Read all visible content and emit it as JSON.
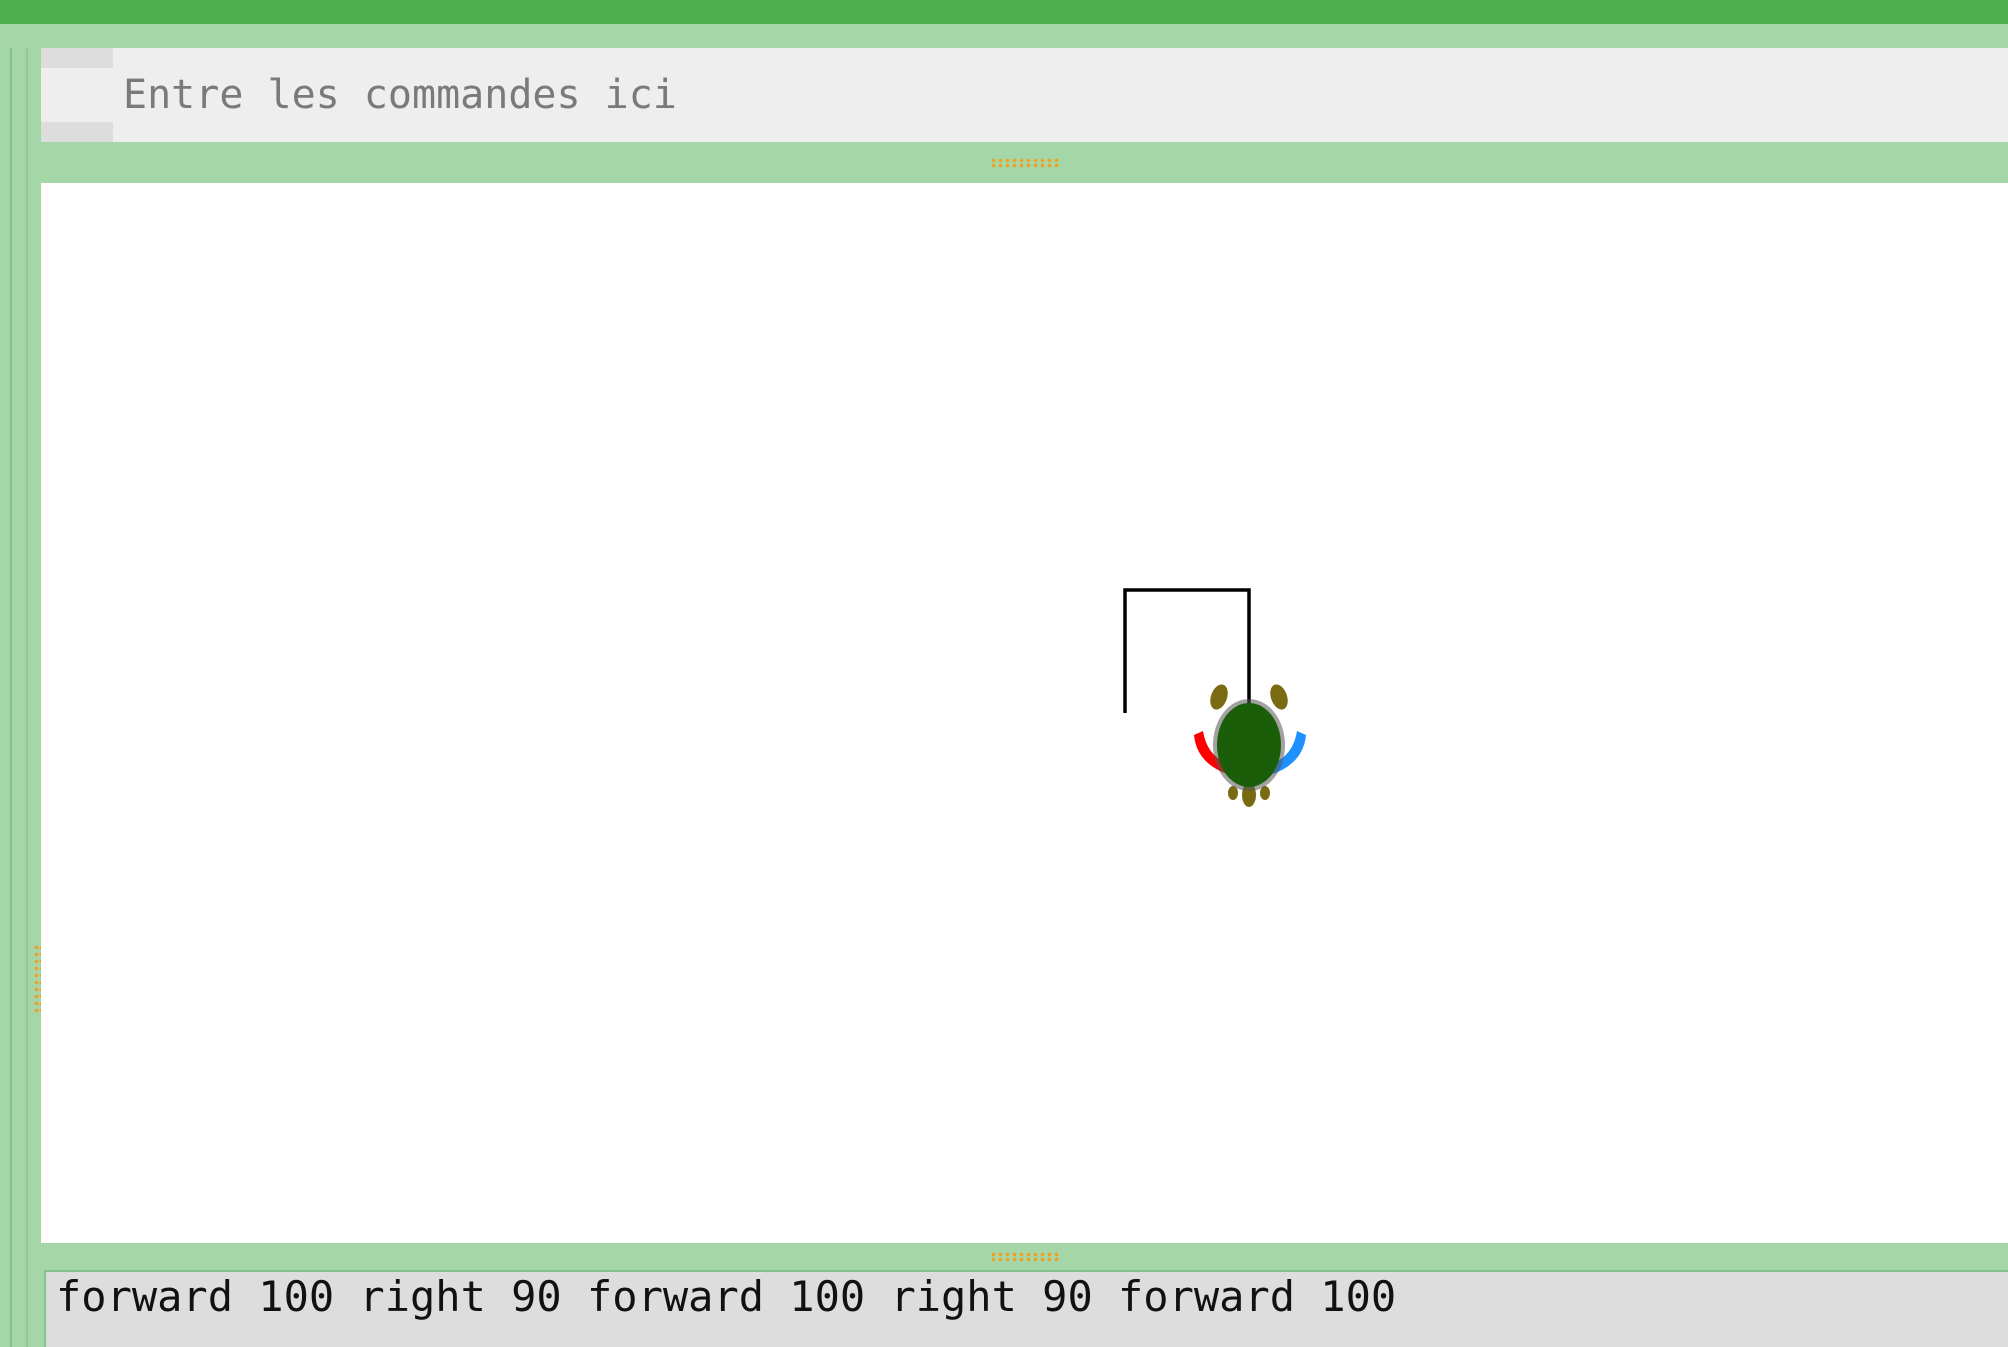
{
  "command_panel": {
    "placeholder": "Entre les commandes ici",
    "value": ""
  },
  "canvas": {
    "turtle": {
      "icon": "turtle-icon",
      "heading": "down",
      "shell_color": "#1b5e0a",
      "limb_color": "#7a6a12",
      "left_fin_color": "#ff0000",
      "right_fin_color": "#1e90ff"
    },
    "trail": {
      "color": "#000000",
      "commands_drawn": [
        "forward 100",
        "right 90",
        "forward 100",
        "right 90",
        "forward 100"
      ]
    }
  },
  "history": {
    "text": "forward 100 right 90 forward 100 right 90 forward 100"
  },
  "colors": {
    "top_bar": "#4caf50",
    "frame": "#a5d6a7",
    "splitter_grip": "#f0a020"
  }
}
